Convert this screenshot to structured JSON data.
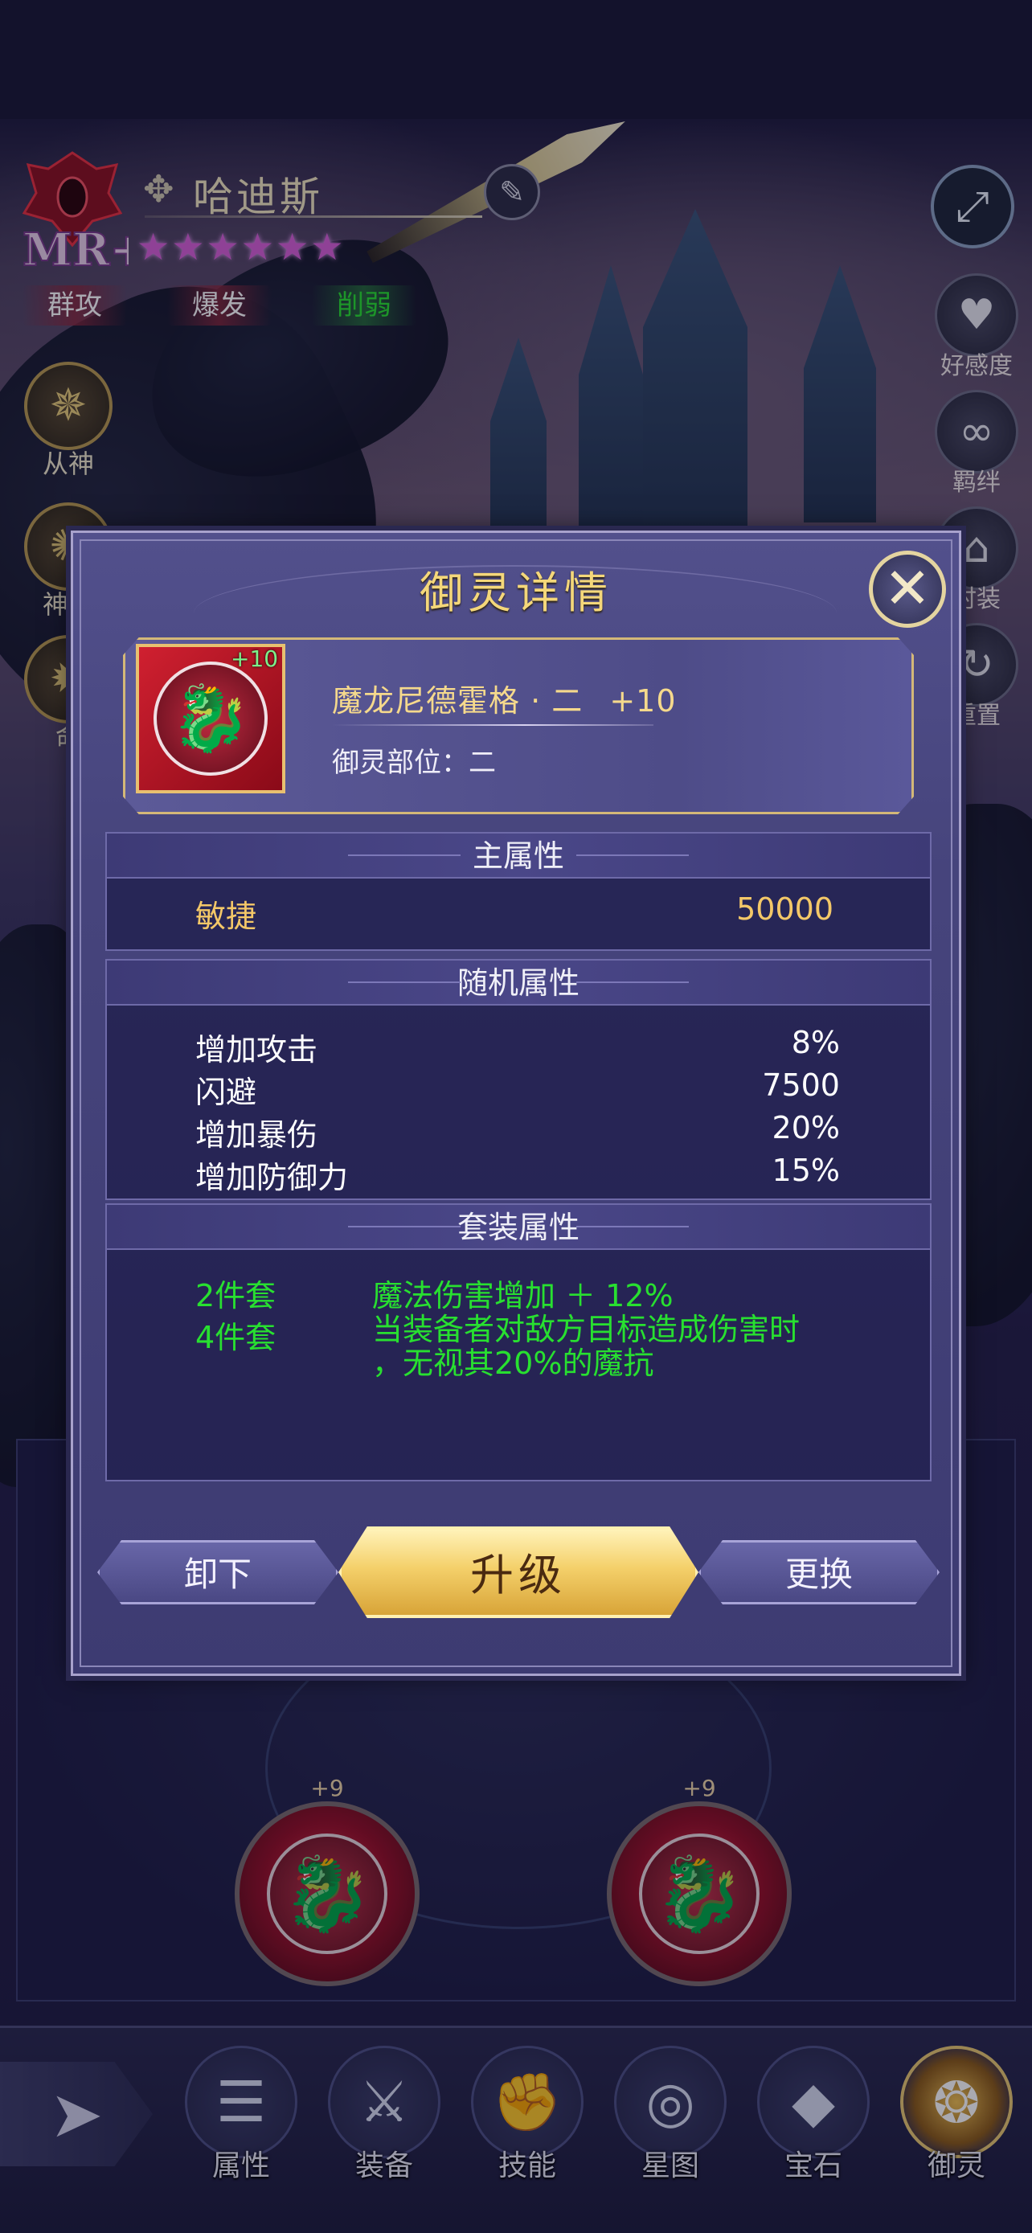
{
  "hero": {
    "name": "哈迪斯",
    "stars": 6,
    "rank_logo": "MR+",
    "tags": [
      "群攻",
      "爆发",
      "削弱"
    ]
  },
  "left_menu": [
    {
      "label": "从神",
      "icon": "compass-icon"
    },
    {
      "label": "神格",
      "icon": "rune-icon"
    },
    {
      "label": "命",
      "icon": "fate-icon"
    }
  ],
  "right_menu": [
    {
      "label": "好感度",
      "icon": "heart-icon"
    },
    {
      "label": "羁绊",
      "icon": "link-icon"
    },
    {
      "label": "时装",
      "icon": "hanger-icon"
    },
    {
      "label": "重置",
      "icon": "refresh-icon"
    }
  ],
  "equipment_orbs": [
    {
      "level": "+9"
    },
    {
      "level": "+9"
    }
  ],
  "bottom_nav": [
    {
      "label": "属性",
      "icon": "list-icon",
      "active": false
    },
    {
      "label": "装备",
      "icon": "sword-icon",
      "active": false
    },
    {
      "label": "技能",
      "icon": "fist-icon",
      "active": false
    },
    {
      "label": "星图",
      "icon": "swirl-icon",
      "active": false
    },
    {
      "label": "宝石",
      "icon": "diamond-icon",
      "active": false
    },
    {
      "label": "御灵",
      "icon": "spirit-icon",
      "active": true
    }
  ],
  "modal": {
    "title": "御灵详情",
    "item": {
      "level_badge": "+10",
      "name": "魔龙尼德霍格 · 二",
      "name_level": "+10",
      "slot_label": "御灵部位：二"
    },
    "main_attr": {
      "header": "主属性",
      "rows": [
        {
          "name": "敏捷",
          "value": "50000"
        }
      ]
    },
    "random_attr": {
      "header": "随机属性",
      "rows": [
        {
          "name": "增加攻击",
          "value": "8%"
        },
        {
          "name": "闪避",
          "value": "7500"
        },
        {
          "name": "增加暴伤",
          "value": "20%"
        },
        {
          "name": "增加防御力",
          "value": "15%"
        }
      ]
    },
    "set_attr": {
      "header": "套装属性",
      "rows": [
        {
          "pieces": "2件套",
          "effect": "魔法伤害增加 ＋ 12%"
        },
        {
          "pieces": "4件套",
          "effect_line1": "当装备者对敌方目标造成伤害时",
          "effect_line2": "，无视其20%的魔抗"
        }
      ]
    },
    "buttons": {
      "unequip": "卸下",
      "upgrade": "升级",
      "replace": "更换"
    }
  },
  "colors": {
    "gold_text": "#f4c868",
    "set_green": "#28e030",
    "panel": "#46447c"
  }
}
